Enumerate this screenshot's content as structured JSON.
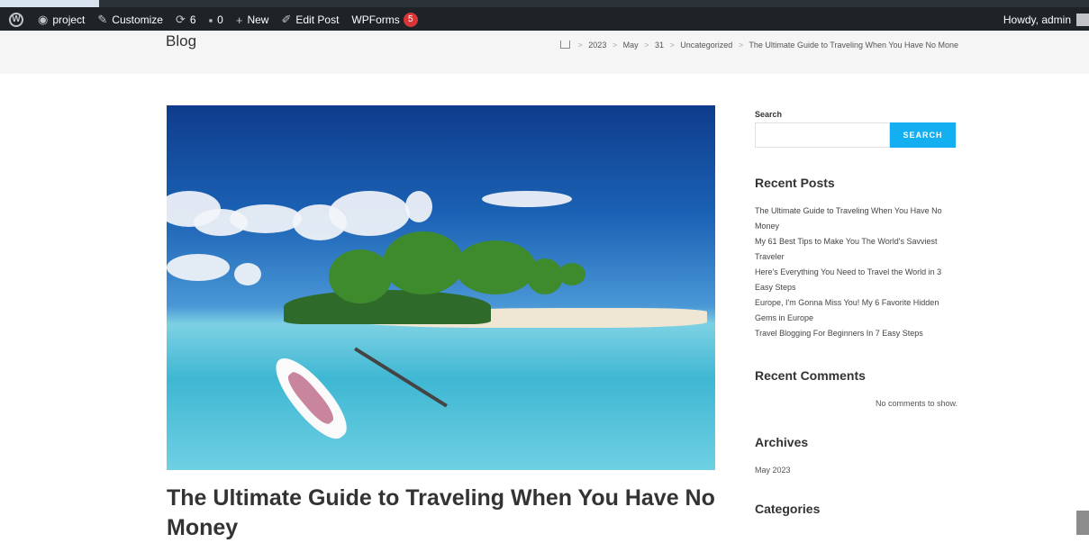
{
  "adminbar": {
    "site_name": "project",
    "customize": "Customize",
    "updates": "6",
    "comments": "0",
    "new": "New",
    "edit_post": "Edit Post",
    "wpforms": "WPForms",
    "wpforms_badge": "5",
    "howdy": "Howdy, admin"
  },
  "header": {
    "title": "Blog",
    "breadcrumb": [
      "2023",
      "May",
      "31",
      "Uncategorized",
      "The Ultimate Guide to Traveling When You Have No Mone"
    ]
  },
  "post": {
    "title": "The Ultimate Guide to Traveling When You Have No Money"
  },
  "sidebar": {
    "search_label": "Search",
    "search_placeholder": "",
    "search_button": "SEARCH",
    "recent_posts_title": "Recent Posts",
    "recent_posts": [
      "The Ultimate Guide to Traveling When You Have No Money",
      "My 61 Best Tips to Make You The World's Savviest Traveler",
      "Here's Everything You Need to Travel the World in 3 Easy Steps",
      "Europe, I'm Gonna Miss You! My 6 Favorite Hidden Gems in Europe",
      "Travel Blogging For Beginners In 7 Easy Steps"
    ],
    "recent_comments_title": "Recent Comments",
    "no_comments": "No comments to show.",
    "archives_title": "Archives",
    "archive_item": "May 2023",
    "categories_title": "Categories"
  }
}
